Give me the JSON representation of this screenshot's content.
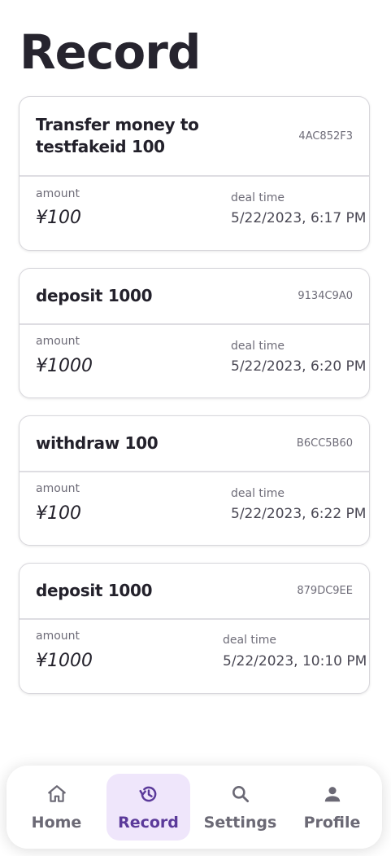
{
  "page": {
    "title": "Record"
  },
  "records": [
    {
      "title": "Transfer money to testfakeid 100",
      "id": "4AC852F3",
      "amount_label": "amount",
      "amount": "¥100",
      "time_label": "deal time",
      "time": "5/22/2023, 6:17 PM"
    },
    {
      "title": "deposit 1000",
      "id": "9134C9A0",
      "amount_label": "amount",
      "amount": "¥1000",
      "time_label": "deal time",
      "time": "5/22/2023, 6:20 PM"
    },
    {
      "title": "withdraw 100",
      "id": "B6CC5B60",
      "amount_label": "amount",
      "amount": "¥100",
      "time_label": "deal time",
      "time": "5/22/2023, 6:22 PM"
    },
    {
      "title": "deposit 1000",
      "id": "879DC9EE",
      "amount_label": "amount",
      "amount": "¥1000",
      "time_label": "deal time",
      "time": "5/22/2023, 10:10 PM"
    }
  ],
  "nav": {
    "items": [
      {
        "label": "Home",
        "icon": "home-icon",
        "active": false
      },
      {
        "label": "Record",
        "icon": "history-icon",
        "active": true
      },
      {
        "label": "Settings",
        "icon": "search-icon",
        "active": false
      },
      {
        "label": "Profile",
        "icon": "person-icon",
        "active": false
      }
    ],
    "colors": {
      "active_bg": "#efe6fb",
      "active_fg": "#5b3a9a",
      "inactive_fg": "#6b6975"
    }
  }
}
